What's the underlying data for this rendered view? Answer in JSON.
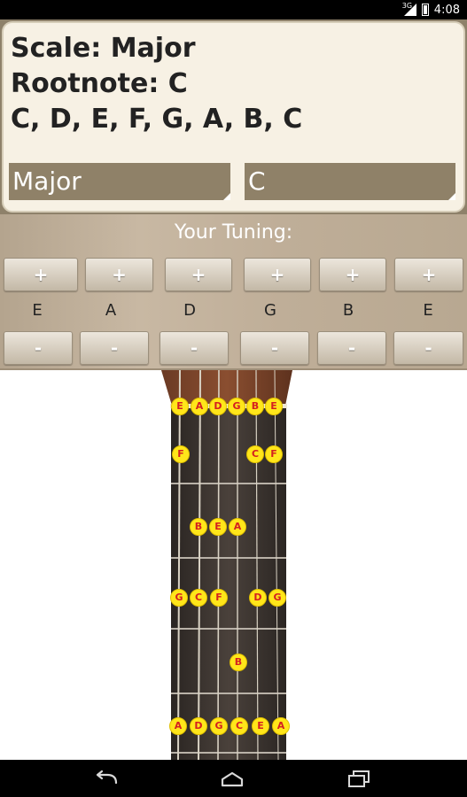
{
  "status_bar": {
    "network": "3G",
    "time": "4:08"
  },
  "info": {
    "scale_line": "Scale: Major",
    "root_line": "Rootnote: C",
    "notes_line": "C, D, E, F, G, A, B, C"
  },
  "spinners": {
    "scale_value": "Major",
    "root_value": "C"
  },
  "tuning": {
    "title": "Your Tuning:",
    "plus_label": "+",
    "minus_label": "-",
    "strings": [
      "E",
      "A",
      "D",
      "G",
      "B",
      "E"
    ]
  },
  "fretboard": {
    "rows": [
      [
        "E",
        "A",
        "D",
        "G",
        "B",
        "E"
      ],
      [
        "F",
        "",
        "",
        "",
        "C",
        "F"
      ],
      [
        "",
        "B",
        "E",
        "A",
        "",
        ""
      ],
      [
        "G",
        "C",
        "F",
        "",
        "D",
        "G"
      ],
      [
        "",
        "",
        "",
        "B",
        "",
        ""
      ],
      [
        "A",
        "D",
        "G",
        "C",
        "E",
        "A"
      ]
    ]
  },
  "nav_bar": {
    "icons": [
      "back-icon",
      "home-icon",
      "recent-apps-icon"
    ]
  },
  "colors": {
    "card_bg": "#f7f1e4",
    "spinner_bg": "#8f8168",
    "note_dot": "#ffe61a",
    "note_text": "#d42020"
  }
}
